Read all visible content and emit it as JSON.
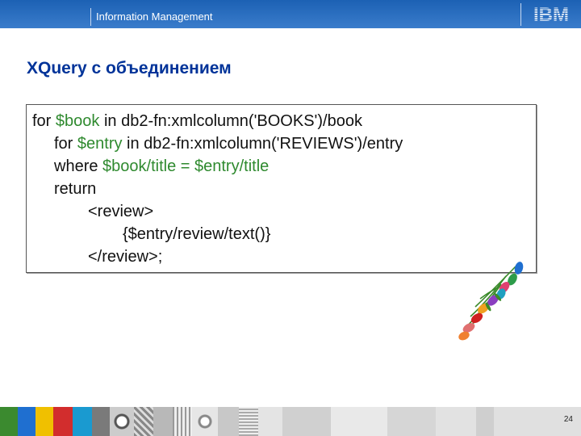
{
  "header": {
    "brand": "Information Management",
    "logo_text": "IBM"
  },
  "slide": {
    "title": "XQuery с объединением",
    "page_number": "24"
  },
  "code": {
    "line1": {
      "a": "for ",
      "v": "$book",
      "b": " in db2-fn:xmlcolumn('BOOKS')/book"
    },
    "line2": {
      "a": "for ",
      "v": "$entry",
      "b": " in db2-fn:xmlcolumn('REVIEWS')/entry"
    },
    "line3": {
      "a": "where ",
      "v": "$book/title = $entry/title",
      "b": ""
    },
    "line4": "return",
    "line5": "<review>",
    "line6": "{$entry/review/text()}",
    "line7": "</review>;"
  },
  "colors": {
    "header_blue": "#1c61b4",
    "title_blue": "#003399",
    "variable_green": "#2f8a2f"
  },
  "icons": [
    "ibm-logo",
    "tulips-clipart"
  ]
}
